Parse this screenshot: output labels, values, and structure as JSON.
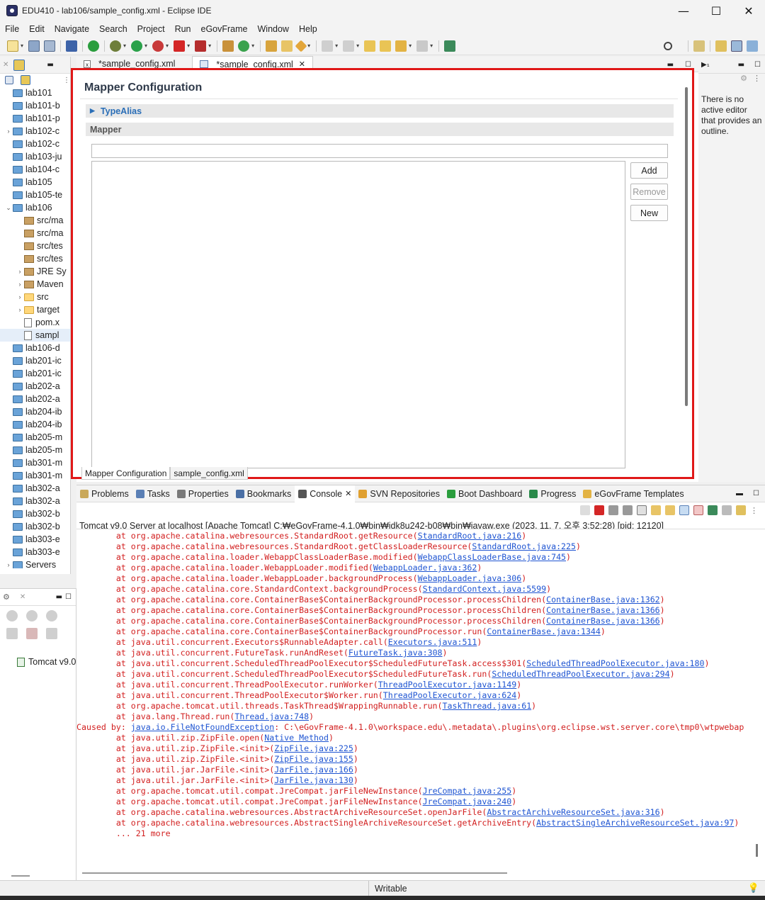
{
  "window": {
    "title": "EDU410 - lab106/sample_config.xml - Eclipse IDE"
  },
  "menu": [
    "File",
    "Edit",
    "Navigate",
    "Search",
    "Project",
    "Run",
    "eGovFrame",
    "Window",
    "Help"
  ],
  "project_explorer": {
    "items": [
      {
        "label": "lab101",
        "level": 0,
        "icon": "project-folder",
        "expand": ""
      },
      {
        "label": "lab101-b",
        "level": 0,
        "icon": "project-folder",
        "expand": ""
      },
      {
        "label": "lab101-p",
        "level": 0,
        "icon": "project-folder",
        "expand": ""
      },
      {
        "label": "lab102-c",
        "level": 0,
        "icon": "maven-project",
        "expand": "›"
      },
      {
        "label": "lab102-c",
        "level": 0,
        "icon": "project-folder",
        "expand": ""
      },
      {
        "label": "lab103-ju",
        "level": 0,
        "icon": "project-folder",
        "expand": ""
      },
      {
        "label": "lab104-c",
        "level": 0,
        "icon": "project-folder",
        "expand": ""
      },
      {
        "label": "lab105",
        "level": 0,
        "icon": "project-folder",
        "expand": ""
      },
      {
        "label": "lab105-te",
        "level": 0,
        "icon": "project-folder",
        "expand": ""
      },
      {
        "label": "lab106",
        "level": 0,
        "icon": "maven-project",
        "expand": "⌄"
      },
      {
        "label": "src/ma",
        "level": 1,
        "icon": "source-folder",
        "expand": ""
      },
      {
        "label": "src/ma",
        "level": 1,
        "icon": "source-folder",
        "expand": ""
      },
      {
        "label": "src/tes",
        "level": 1,
        "icon": "source-folder",
        "expand": ""
      },
      {
        "label": "src/tes",
        "level": 1,
        "icon": "source-folder",
        "expand": ""
      },
      {
        "label": "JRE Sy",
        "level": 1,
        "icon": "library",
        "expand": "›"
      },
      {
        "label": "Maven",
        "level": 1,
        "icon": "library",
        "expand": "›"
      },
      {
        "label": "src",
        "level": 1,
        "icon": "folder",
        "expand": "›"
      },
      {
        "label": "target",
        "level": 1,
        "icon": "folder",
        "expand": "›"
      },
      {
        "label": "pom.x",
        "level": 1,
        "icon": "pom-file",
        "expand": ""
      },
      {
        "label": "sampl",
        "level": 1,
        "icon": "xml-file",
        "expand": "",
        "selected": true
      },
      {
        "label": "lab106-d",
        "level": 0,
        "icon": "project-folder",
        "expand": ""
      },
      {
        "label": "lab201-ic",
        "level": 0,
        "icon": "project-folder",
        "expand": ""
      },
      {
        "label": "lab201-ic",
        "level": 0,
        "icon": "project-folder",
        "expand": ""
      },
      {
        "label": "lab202-a",
        "level": 0,
        "icon": "project-folder",
        "expand": ""
      },
      {
        "label": "lab202-a",
        "level": 0,
        "icon": "project-folder",
        "expand": ""
      },
      {
        "label": "lab204-ib",
        "level": 0,
        "icon": "project-folder",
        "expand": ""
      },
      {
        "label": "lab204-ib",
        "level": 0,
        "icon": "project-folder",
        "expand": ""
      },
      {
        "label": "lab205-m",
        "level": 0,
        "icon": "project-folder",
        "expand": ""
      },
      {
        "label": "lab205-m",
        "level": 0,
        "icon": "project-folder",
        "expand": ""
      },
      {
        "label": "lab301-m",
        "level": 0,
        "icon": "project-folder",
        "expand": ""
      },
      {
        "label": "lab301-m",
        "level": 0,
        "icon": "project-folder",
        "expand": ""
      },
      {
        "label": "lab302-a",
        "level": 0,
        "icon": "project-folder",
        "expand": ""
      },
      {
        "label": "lab302-a",
        "level": 0,
        "icon": "project-folder",
        "expand": ""
      },
      {
        "label": "lab302-b",
        "level": 0,
        "icon": "project-folder",
        "expand": ""
      },
      {
        "label": "lab302-b",
        "level": 0,
        "icon": "project-folder",
        "expand": ""
      },
      {
        "label": "lab303-e",
        "level": 0,
        "icon": "project-folder",
        "expand": ""
      },
      {
        "label": "lab303-e",
        "level": 0,
        "icon": "project-folder",
        "expand": ""
      },
      {
        "label": "Servers",
        "level": 0,
        "icon": "project-folder",
        "expand": "›"
      }
    ]
  },
  "servers": {
    "item": "Tomcat v9.0"
  },
  "editor": {
    "tabs": [
      "*sample_config.xml",
      "*sample_config.xml"
    ],
    "heading": "Mapper Configuration",
    "section_typealias": "TypeAlias",
    "section_mapper": "Mapper",
    "add_label": "Add",
    "remove_label": "Remove",
    "new_label": "New",
    "bottom_tabs": [
      "Mapper Configuration",
      "sample_config.xml"
    ]
  },
  "outline": {
    "message": "There is no active editor that provides an outline."
  },
  "bottom_views": [
    "Problems",
    "Tasks",
    "Properties",
    "Bookmarks",
    "Console",
    "SVN Repositories",
    "Boot Dashboard",
    "Progress",
    "eGovFrame Templates"
  ],
  "console": {
    "header": "Tomcat v9.0 Server at localhost [Apache Tomcat] C:₩eGovFrame-4.1.0₩bin₩jdk8u242-b08₩bin₩javaw.exe  (2023. 11. 7. 오후 3:52:28) [pid: 12120]",
    "lines": [
      {
        "pre": "        at org.apache.catalina.webresources.StandardRoot.getResource(",
        "link": "StandardRoot.java:216",
        "post": ")"
      },
      {
        "pre": "        at org.apache.catalina.webresources.StandardRoot.getClassLoaderResource(",
        "link": "StandardRoot.java:225",
        "post": ")"
      },
      {
        "pre": "        at org.apache.catalina.loader.WebappClassLoaderBase.modified(",
        "link": "WebappClassLoaderBase.java:745",
        "post": ")"
      },
      {
        "pre": "        at org.apache.catalina.loader.WebappLoader.modified(",
        "link": "WebappLoader.java:362",
        "post": ")"
      },
      {
        "pre": "        at org.apache.catalina.loader.WebappLoader.backgroundProcess(",
        "link": "WebappLoader.java:306",
        "post": ")"
      },
      {
        "pre": "        at org.apache.catalina.core.StandardContext.backgroundProcess(",
        "link": "StandardContext.java:5599",
        "post": ")"
      },
      {
        "pre": "        at org.apache.catalina.core.ContainerBase$ContainerBackgroundProcessor.processChildren(",
        "link": "ContainerBase.java:1362",
        "post": ")"
      },
      {
        "pre": "        at org.apache.catalina.core.ContainerBase$ContainerBackgroundProcessor.processChildren(",
        "link": "ContainerBase.java:1366",
        "post": ")"
      },
      {
        "pre": "        at org.apache.catalina.core.ContainerBase$ContainerBackgroundProcessor.processChildren(",
        "link": "ContainerBase.java:1366",
        "post": ")"
      },
      {
        "pre": "        at org.apache.catalina.core.ContainerBase$ContainerBackgroundProcessor.run(",
        "link": "ContainerBase.java:1344",
        "post": ")"
      },
      {
        "pre": "        at java.util.concurrent.Executors$RunnableAdapter.call(",
        "link": "Executors.java:511",
        "post": ")"
      },
      {
        "pre": "        at java.util.concurrent.FutureTask.runAndReset(",
        "link": "FutureTask.java:308",
        "post": ")"
      },
      {
        "pre": "        at java.util.concurrent.ScheduledThreadPoolExecutor$ScheduledFutureTask.access$301(",
        "link": "ScheduledThreadPoolExecutor.java:180",
        "post": ")"
      },
      {
        "pre": "        at java.util.concurrent.ScheduledThreadPoolExecutor$ScheduledFutureTask.run(",
        "link": "ScheduledThreadPoolExecutor.java:294",
        "post": ")"
      },
      {
        "pre": "        at java.util.concurrent.ThreadPoolExecutor.runWorker(",
        "link": "ThreadPoolExecutor.java:1149",
        "post": ")"
      },
      {
        "pre": "        at java.util.concurrent.ThreadPoolExecutor$Worker.run(",
        "link": "ThreadPoolExecutor.java:624",
        "post": ")"
      },
      {
        "pre": "        at org.apache.tomcat.util.threads.TaskThread$WrappingRunnable.run(",
        "link": "TaskThread.java:61",
        "post": ")"
      },
      {
        "pre": "        at java.lang.Thread.run(",
        "link": "Thread.java:748",
        "post": ")"
      },
      {
        "pre": "Caused by: ",
        "link": "java.io.FileNotFoundException",
        "post": ": C:\\eGovFrame-4.1.0\\workspace.edu\\.metadata\\.plugins\\org.eclipse.wst.server.core\\tmp0\\wtpwebap"
      },
      {
        "pre": "        at java.util.zip.ZipFile.open(",
        "link": "Native Method",
        "post": ")"
      },
      {
        "pre": "        at java.util.zip.ZipFile.<init>(",
        "link": "ZipFile.java:225",
        "post": ")"
      },
      {
        "pre": "        at java.util.zip.ZipFile.<init>(",
        "link": "ZipFile.java:155",
        "post": ")"
      },
      {
        "pre": "        at java.util.jar.JarFile.<init>(",
        "link": "JarFile.java:166",
        "post": ")"
      },
      {
        "pre": "        at java.util.jar.JarFile.<init>(",
        "link": "JarFile.java:130",
        "post": ")"
      },
      {
        "pre": "        at org.apache.tomcat.util.compat.JreCompat.jarFileNewInstance(",
        "link": "JreCompat.java:255",
        "post": ")"
      },
      {
        "pre": "        at org.apache.tomcat.util.compat.JreCompat.jarFileNewInstance(",
        "link": "JreCompat.java:240",
        "post": ")"
      },
      {
        "pre": "        at org.apache.catalina.webresources.AbstractArchiveResourceSet.openJarFile(",
        "link": "AbstractArchiveResourceSet.java:316",
        "post": ")"
      },
      {
        "pre": "        at org.apache.catalina.webresources.AbstractSingleArchiveResourceSet.getArchiveEntry(",
        "link": "AbstractSingleArchiveResourceSet.java:97",
        "post": ")"
      },
      {
        "pre": "        ... 21 more",
        "link": "",
        "post": ""
      }
    ]
  },
  "status": {
    "writable": "Writable"
  },
  "colors": {
    "highlight_border": "#e01818",
    "error_text": "#d21f1f",
    "link": "#1f55d2"
  }
}
